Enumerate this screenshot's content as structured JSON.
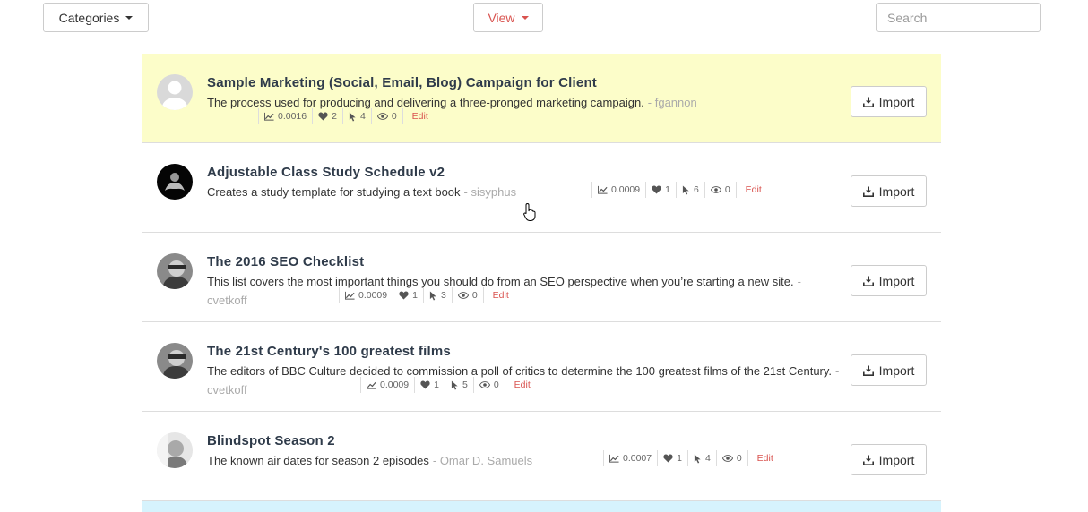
{
  "toolbar": {
    "categories_label": "Categories",
    "view_label": "View",
    "search_placeholder": "Search"
  },
  "accent_color": "#d9534f",
  "items": [
    {
      "title": "Sample Marketing (Social, Email, Blog) Campaign for Client",
      "description": "The process used for producing and delivering a three-pronged marketing campaign.",
      "author": "- fgannon",
      "score": "0.0016",
      "likes": "2",
      "clicks": "4",
      "views": "0",
      "edit_label": "Edit",
      "import_label": "Import"
    },
    {
      "title": "Adjustable Class Study Schedule v2",
      "description": "Creates a study template for studying a text book",
      "author": "- sisyphus",
      "score": "0.0009",
      "likes": "1",
      "clicks": "6",
      "views": "0",
      "edit_label": "Edit",
      "import_label": "Import"
    },
    {
      "title": "The 2016 SEO Checklist",
      "description": "This list covers the most important things you should do from an SEO perspective when you’re starting a new site.",
      "author": "- cvetkoff",
      "score": "0.0009",
      "likes": "1",
      "clicks": "3",
      "views": "0",
      "edit_label": "Edit",
      "import_label": "Import"
    },
    {
      "title": "The 21st Century's 100 greatest films",
      "description": "The editors of BBC Culture decided to commission a poll of critics to determine the 100 greatest films of the 21st Century.",
      "author": "- cvetkoff",
      "score": "0.0009",
      "likes": "1",
      "clicks": "5",
      "views": "0",
      "edit_label": "Edit",
      "import_label": "Import"
    },
    {
      "title": "Blindspot Season 2",
      "description": "The known air dates for season 2 episodes",
      "author": "- Omar D. Samuels",
      "score": "0.0007",
      "likes": "1",
      "clicks": "4",
      "views": "0",
      "edit_label": "Edit",
      "import_label": "Import"
    }
  ]
}
